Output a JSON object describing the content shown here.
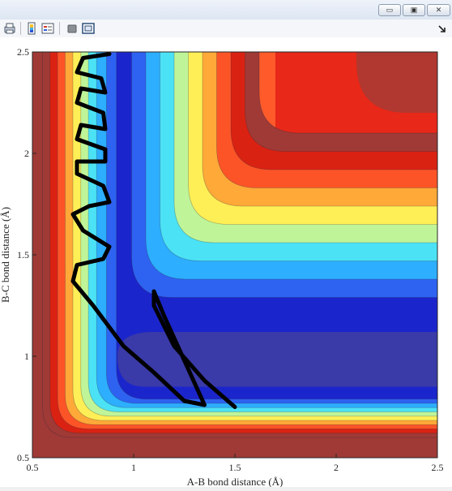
{
  "window": {
    "buttons": [
      {
        "name": "minimize-button",
        "glyph": "▭"
      },
      {
        "name": "restore-button",
        "glyph": "▣"
      },
      {
        "name": "close-button",
        "glyph": "✕"
      }
    ]
  },
  "toolbar": {
    "icons": [
      "print-figure-icon",
      "colorbar-icon",
      "legend-icon",
      "hide-plot-tools-icon",
      "show-plot-tools-icon",
      "dock-arrow-icon"
    ]
  },
  "chart_data": {
    "type": "contour",
    "xlabel": "A-B bond distance (Å)",
    "ylabel": "B-C bond distance (Å)",
    "xlim": [
      0.5,
      2.5
    ],
    "ylim": [
      0.5,
      2.5
    ],
    "xticks": [
      "0.5",
      "1",
      "1.5",
      "2",
      "2.5"
    ],
    "yticks": [
      "0.5",
      "1",
      "1.5",
      "2",
      "2.5"
    ],
    "colormap": [
      "#1a1ec8",
      "#2f5bf0",
      "#2aa8ff",
      "#3fe0ff",
      "#b8f5a0",
      "#fff65a",
      "#ffb33b",
      "#ff5a2a",
      "#e02010",
      "#a03a36"
    ],
    "trajectory": [
      [
        1.5,
        0.75
      ],
      [
        1.35,
        0.88
      ],
      [
        1.2,
        1.05
      ],
      [
        1.1,
        1.25
      ],
      [
        1.1,
        1.32
      ],
      [
        1.15,
        1.2
      ],
      [
        1.25,
        0.98
      ],
      [
        1.35,
        0.76
      ],
      [
        1.25,
        0.78
      ],
      [
        1.1,
        0.92
      ],
      [
        0.95,
        1.05
      ],
      [
        0.8,
        1.25
      ],
      [
        0.7,
        1.37
      ],
      [
        0.72,
        1.45
      ],
      [
        0.85,
        1.48
      ],
      [
        0.88,
        1.54
      ],
      [
        0.75,
        1.62
      ],
      [
        0.7,
        1.7
      ],
      [
        0.78,
        1.74
      ],
      [
        0.88,
        1.76
      ],
      [
        0.85,
        1.84
      ],
      [
        0.72,
        1.9
      ],
      [
        0.72,
        1.96
      ],
      [
        0.86,
        1.96
      ],
      [
        0.86,
        2.02
      ],
      [
        0.72,
        2.07
      ],
      [
        0.74,
        2.14
      ],
      [
        0.86,
        2.12
      ],
      [
        0.85,
        2.2
      ],
      [
        0.72,
        2.25
      ],
      [
        0.74,
        2.32
      ],
      [
        0.86,
        2.3
      ],
      [
        0.84,
        2.37
      ],
      [
        0.72,
        2.4
      ],
      [
        0.75,
        2.47
      ],
      [
        0.88,
        2.49
      ]
    ]
  }
}
